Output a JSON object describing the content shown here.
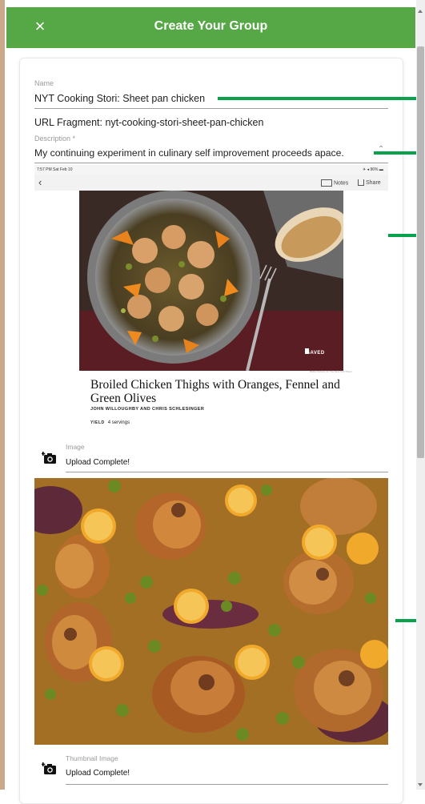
{
  "header": {
    "title": "Create Your Group",
    "close_glyph": "×"
  },
  "form": {
    "name": {
      "label": "Name",
      "value": "NYT Cooking Stori: Sheet pan chicken"
    },
    "url_fragment": "URL Fragment: nyt-cooking-stori-sheet-pan-chicken",
    "description": {
      "label": "Description *",
      "value": "My continuing experiment in culinary self improvement proceeds apace."
    },
    "image": {
      "label": "Image",
      "status": "Upload Complete!"
    },
    "thumbnail": {
      "label": "Thumbnail Image",
      "status": "Upload Complete!"
    }
  },
  "recipe_screenshot": {
    "status_time": "7:57 PM  Sat Feb 10",
    "status_battery": "✈ ◂ 96% ▬",
    "notes_label": "Notes",
    "share_label": "Share",
    "saved_badge": "SAVED",
    "photo_credit": "Bobby Doherty for The New York Times",
    "title": "Broiled Chicken Thighs with Oranges, Fennel and Green Olives",
    "authors": "JOHN WILLOUGHBY AND CHRIS SCHLESINGER",
    "yield_label": "YIELD",
    "yield_value": "4 servings"
  },
  "icons": [
    "close-icon",
    "add-photo-icon",
    "chevron-left-icon",
    "notes-icon",
    "share-icon",
    "bookmark-icon"
  ],
  "colors": {
    "header": "#55a845",
    "annotation": "#08a24d"
  }
}
